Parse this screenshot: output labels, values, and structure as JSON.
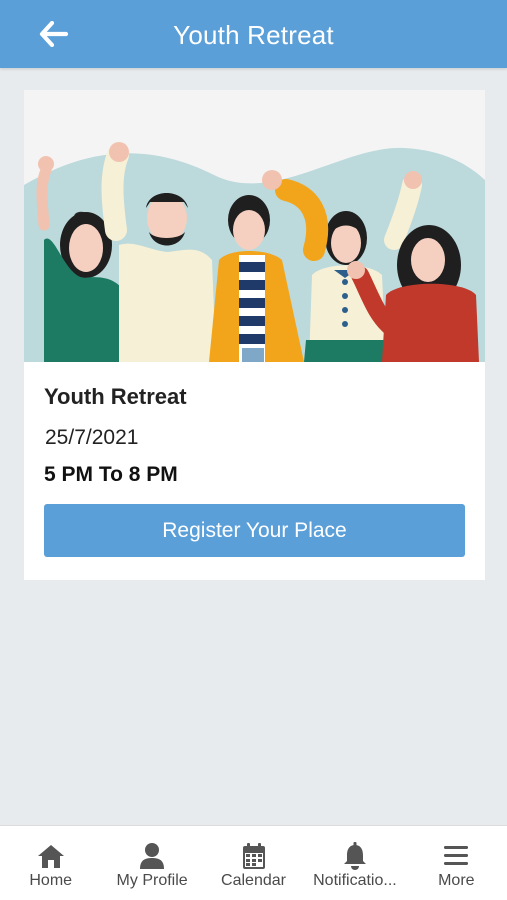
{
  "header": {
    "title": "Youth Retreat",
    "back_icon": "arrow-left-icon"
  },
  "colors": {
    "primary": "#5b9fd9",
    "background": "#e8ebed",
    "nav_icon": "#555555"
  },
  "event": {
    "title": "Youth Retreat",
    "date": "25/7/2021",
    "time": "5 PM To 8 PM",
    "register_label": "Register Your Place"
  },
  "bottom_nav": {
    "items": [
      {
        "label": "Home",
        "icon": "home-icon"
      },
      {
        "label": "My Profile",
        "icon": "user-icon"
      },
      {
        "label": "Calendar",
        "icon": "calendar-icon"
      },
      {
        "label": "Notificatio...",
        "icon": "bell-icon"
      },
      {
        "label": "More",
        "icon": "menu-icon"
      }
    ]
  }
}
